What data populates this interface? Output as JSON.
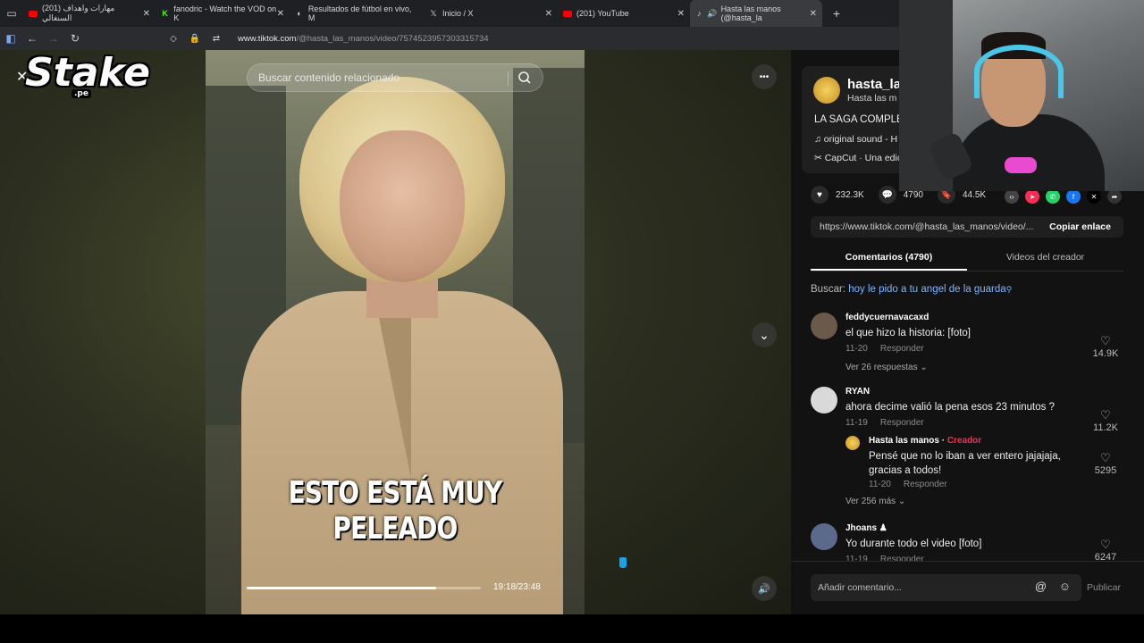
{
  "browser": {
    "tabs": [
      {
        "label": "(201) مهارات واهداف السنغالي",
        "icon": "youtube-icon"
      },
      {
        "label": "fanodric - Watch the VOD on K",
        "icon": "kick-icon"
      },
      {
        "label": "Resultados de fútbol en vivo, M",
        "icon": "globe-icon"
      },
      {
        "label": "Inicio / X",
        "icon": "x-icon"
      },
      {
        "label": "(201) YouTube",
        "icon": "youtube-icon"
      },
      {
        "label": "Hasta las manos (@hasta_la",
        "icon": "tiktok-icon"
      }
    ],
    "new_tab_label": "+",
    "url_prefix": "www.tiktok.com",
    "url_path": "/@hasta_las_manos/video/7574523957303315734"
  },
  "video": {
    "search_placeholder": "Buscar contenido relacionado",
    "subtitle": "ESTO ESTÁ MUY PELEADO",
    "time": "19:18/23:48",
    "progress": 0.81,
    "more_label": "•••"
  },
  "overlay": {
    "brand": "Stake",
    "brand_suffix": ".pe"
  },
  "author": {
    "handle": "hasta_las",
    "display": "Hasta las m",
    "description": "LA SAGA COMPLE",
    "music": "original sound - H",
    "capcut": "CapCut · Una edic"
  },
  "stats": {
    "likes": "232.3K",
    "comments": "4790",
    "saves": "44.5K"
  },
  "share": {
    "link": "https://www.tiktok.com/@hasta_las_manos/video/...",
    "copy_label": "Copiar enlace"
  },
  "tabs": {
    "comments": "Comentarios (4790)",
    "creator_videos": "Videos del creador"
  },
  "search_suggestion": {
    "prefix": "Buscar:",
    "query": "hoy le pido a tu angel de la guarda"
  },
  "comments": [
    {
      "user": "feddycuernavacaxd",
      "text": "el que hizo la historia: [foto]",
      "date": "11-20",
      "reply": "Responder",
      "likes": "14.9K",
      "more": "Ver 26 respuestas"
    },
    {
      "user": "RYAN",
      "text": "ahora decime valió la pena esos 23 minutos ?",
      "date": "11-19",
      "reply": "Responder",
      "likes": "11.2K"
    },
    {
      "user": "Hasta las manos",
      "badge": "Creador",
      "text": "Pensé que no lo iban a ver entero jajajaja, gracias a todos!",
      "date": "11-20",
      "reply": "Responder",
      "likes": "5295",
      "more": "Ver 256 más"
    },
    {
      "user": "Jhoans",
      "text": "Yo durante todo el video [foto]",
      "date": "11-19",
      "reply": "Responder",
      "likes": "6247"
    }
  ],
  "composer": {
    "placeholder": "Añadir comentario...",
    "publish": "Publicar"
  }
}
